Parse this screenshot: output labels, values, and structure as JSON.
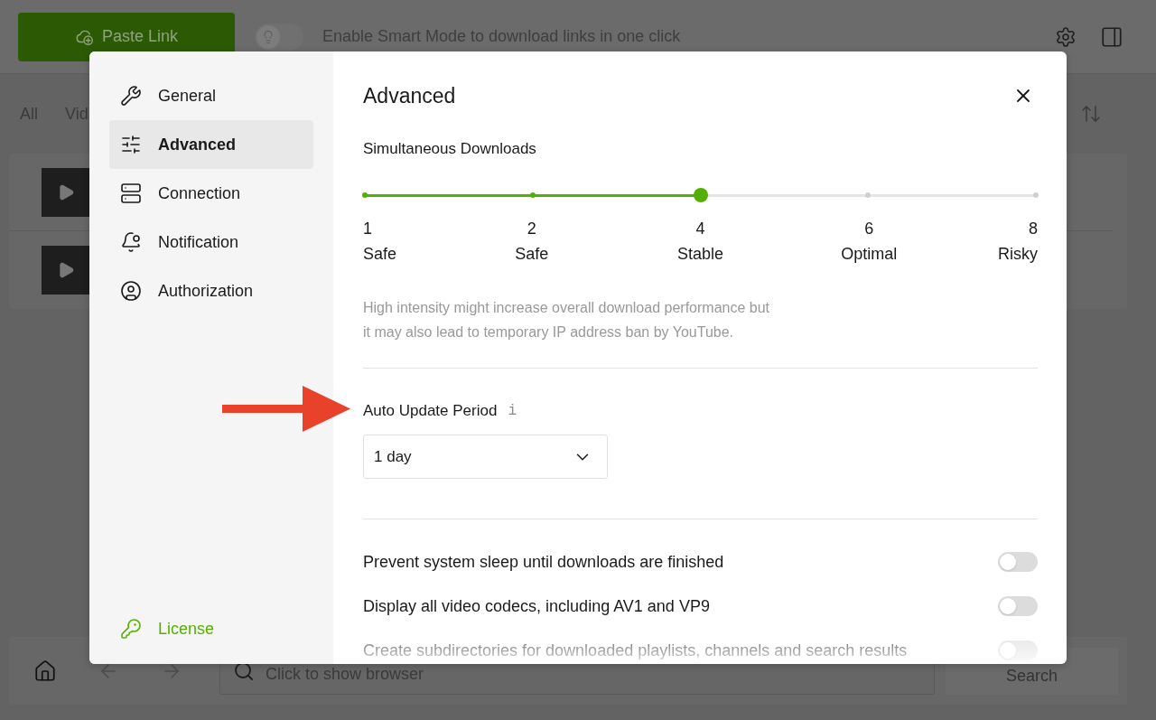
{
  "app": {
    "paste_button": {
      "label": "Paste Link"
    },
    "smart_mode": {
      "on": false,
      "label": "Enable Smart Mode to download links in one click"
    },
    "filter_tabs": [
      {
        "label": "All"
      },
      {
        "label": "Vid"
      }
    ],
    "browser_bar": {
      "placeholder": "Click to show browser",
      "search_button": "Search"
    }
  },
  "dialog": {
    "sidebar": {
      "items": [
        {
          "label": "General",
          "selected": false
        },
        {
          "label": "Advanced",
          "selected": true
        },
        {
          "label": "Connection",
          "selected": false
        },
        {
          "label": "Notification",
          "selected": false
        },
        {
          "label": "Authorization",
          "selected": false
        }
      ],
      "license": "License"
    },
    "title": "Advanced",
    "simultaneous_downloads": {
      "label": "Simultaneous Downloads",
      "level": 0.5,
      "stops": [
        {
          "value": "1",
          "caption": "Safe"
        },
        {
          "value": "2",
          "caption": "Safe"
        },
        {
          "value": "4",
          "caption": "Stable"
        },
        {
          "value": "6",
          "caption": "Optimal"
        },
        {
          "value": "8",
          "caption": "Risky"
        }
      ],
      "note": "High intensity might increase overall download performance but it may also lead to temporary IP address ban by YouTube."
    },
    "auto_update": {
      "label": "Auto Update Period",
      "info": "i",
      "value": "1 day"
    },
    "toggles": [
      {
        "label": "Prevent system sleep until downloads are finished",
        "on": false
      },
      {
        "label": "Display all video codecs, including AV1 and VP9",
        "on": false
      },
      {
        "label": "Create subdirectories for downloaded playlists, channels and search results",
        "on": false
      }
    ]
  }
}
